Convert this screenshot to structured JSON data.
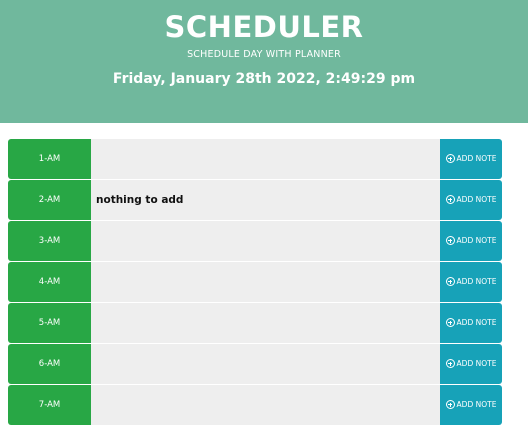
{
  "header": {
    "title": "SCHEDULER",
    "subtitle": "SCHEDULE DAY WITH PLANNER",
    "current_day": "Friday, January 28th 2022, 2:49:29 pm"
  },
  "timeblocks": [
    {
      "hour": "1-AM",
      "note": "",
      "button": "ADD NOTE"
    },
    {
      "hour": "2-AM",
      "note": "nothing to add",
      "button": "ADD NOTE"
    },
    {
      "hour": "3-AM",
      "note": "",
      "button": "ADD NOTE"
    },
    {
      "hour": "4-AM",
      "note": "",
      "button": "ADD NOTE"
    },
    {
      "hour": "5-AM",
      "note": "",
      "button": "ADD NOTE"
    },
    {
      "hour": "6-AM",
      "note": "",
      "button": "ADD NOTE"
    },
    {
      "hour": "7-AM",
      "note": "",
      "button": "ADD NOTE"
    }
  ],
  "colors": {
    "header": "#70b89d",
    "hour": "#28a745",
    "note": "#eeeeee",
    "button": "#17a2b8"
  },
  "icons": {
    "save": "plus-circle-icon"
  }
}
